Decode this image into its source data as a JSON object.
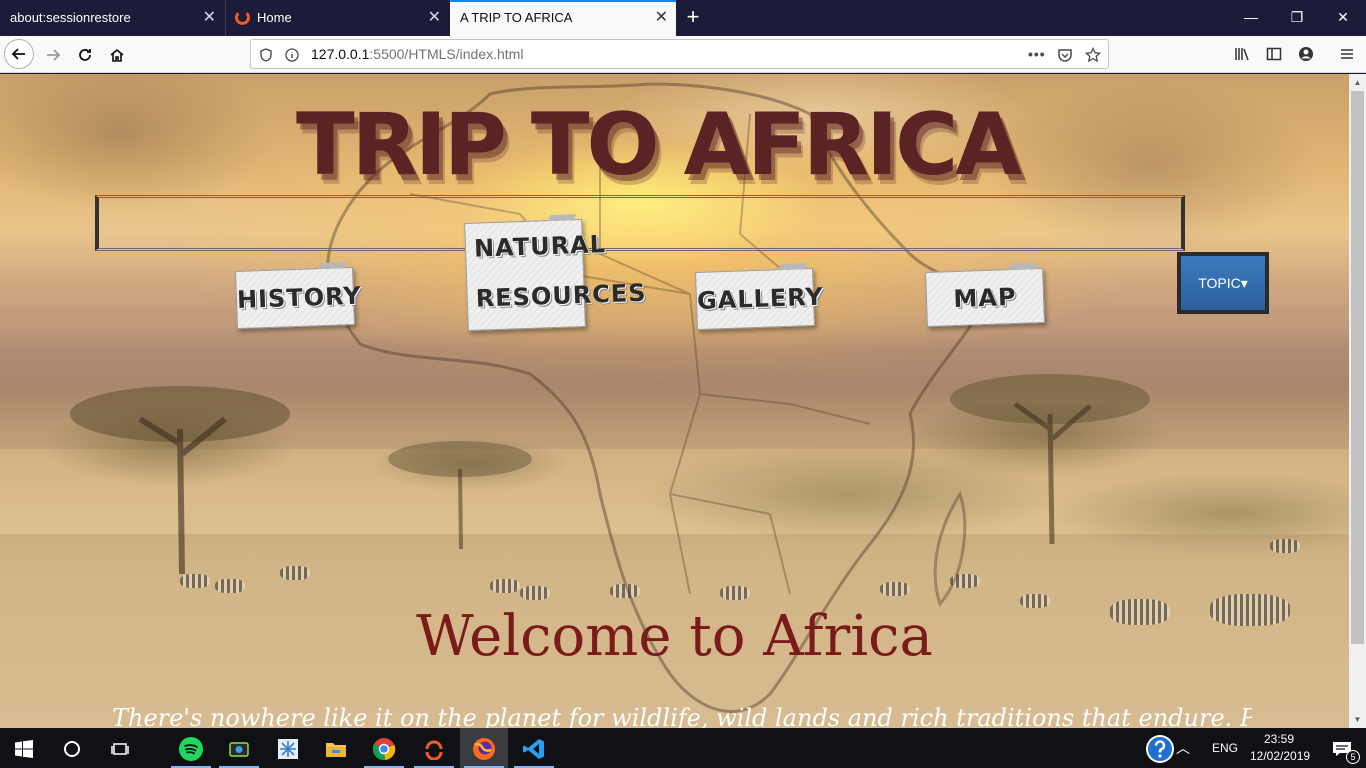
{
  "browser": {
    "tabs": [
      {
        "label": "about:sessionrestore",
        "active": false
      },
      {
        "label": "Home",
        "active": false
      },
      {
        "label": "A TRIP TO AFRICA",
        "active": true
      }
    ],
    "new_tab_label": "+",
    "url_host": "127.0.0.1",
    "url_rest": ":5500/HTMLS/index.html"
  },
  "page": {
    "site_title": "TRIP TO AFRICA",
    "nav": [
      {
        "label": "HISTORY"
      },
      {
        "label_line1": "NATURAL",
        "label_line2": "RESOURCES"
      },
      {
        "label": "GALLERY"
      },
      {
        "label": "MAP"
      }
    ],
    "topic_button": "TOPIC▾",
    "welcome": "Welcome to Africa",
    "intro": "There's nowhere like it on the planet for wildlife, wild lands and rich traditions that endure. Prepare"
  },
  "taskbar": {
    "language": "ENG",
    "time": "23:59",
    "date": "12/02/2019",
    "notification_count": "5"
  },
  "colors": {
    "title": "#5a2424",
    "welcome": "#7a1a1a",
    "topic_button": "#2f6aa8",
    "tab_accent": "#0a84ff"
  }
}
